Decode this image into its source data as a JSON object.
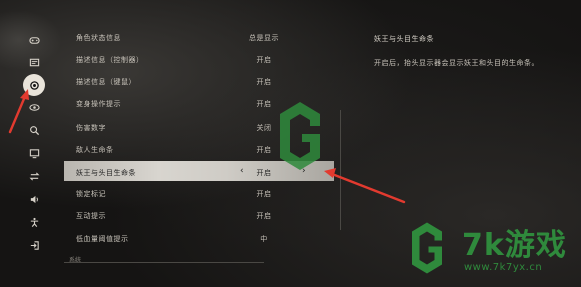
{
  "settings": {
    "rows": [
      {
        "label": "角色状态信息",
        "value": "总是显示"
      },
      {
        "label": "描述信息（控制器）",
        "value": "开启"
      },
      {
        "label": "描述信息（键鼠）",
        "value": "开启"
      },
      {
        "label": "变身操作提示",
        "value": "开启"
      },
      {
        "label": "伤害数字",
        "value": "关闭"
      },
      {
        "label": "敌人生命条",
        "value": "开启"
      },
      {
        "label": "妖王与头目生命条",
        "value": "开启",
        "prev": "‹",
        "next": "›"
      },
      {
        "label": "锁定标记",
        "value": "开启"
      },
      {
        "label": "互动提示",
        "value": "开启"
      },
      {
        "label": "低血量阈值提示",
        "value": "中"
      }
    ],
    "section_label": "系统"
  },
  "description": {
    "title": "妖王与头目生命条",
    "text": "开启后，抬头显示器会显示妖王和头目的生命条。"
  },
  "watermark": {
    "brand": "7k游戏",
    "url": "www.7k7yx.cn"
  },
  "nav_icons": [
    "gamepad-icon",
    "controller-settings-icon",
    "display-icon",
    "eye-icon",
    "search-icon",
    "monitor-icon",
    "swap-icon",
    "volume-icon",
    "accessibility-icon",
    "exit-icon"
  ],
  "colors": {
    "accent_red": "#e23a2f",
    "watermark_green": "#2f8a3c",
    "selected_row": "#d8d5cf"
  }
}
